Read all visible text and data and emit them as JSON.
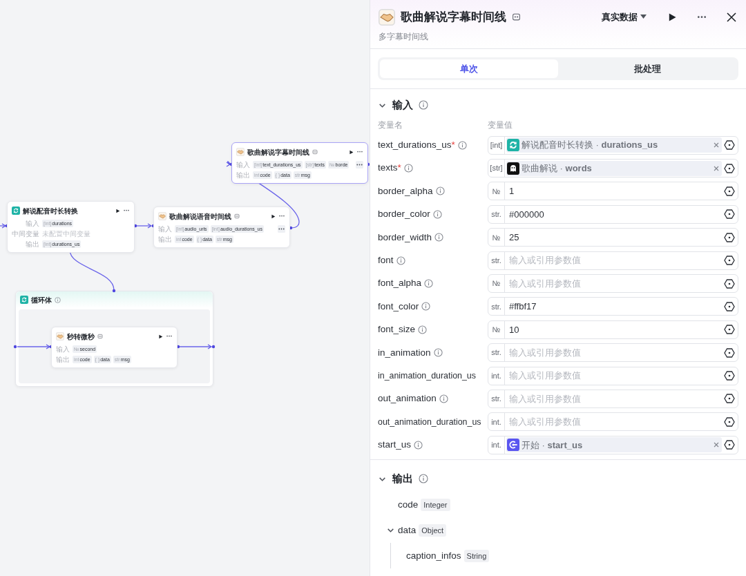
{
  "canvas": {
    "nodes": [
      {
        "title": "解说配音时长转换",
        "kind": "loop",
        "rows": [
          {
            "label": "输入",
            "tags": [
              {
                "type": "[int]",
                "name": "durations"
              }
            ]
          },
          {
            "label": "中间变量",
            "text": "未配置中间变量"
          },
          {
            "label": "输出",
            "tags": [
              {
                "type": "[int]",
                "name": "durations_us"
              }
            ]
          }
        ]
      },
      {
        "title": "歌曲解说语音时间线",
        "kind": "plugin",
        "edit_icon": true,
        "rows": [
          {
            "label": "输入",
            "tags": [
              {
                "type": "[int]",
                "name": "audio_urls"
              },
              {
                "type": "[int]",
                "name": "audio_durations_us"
              }
            ],
            "more": true
          },
          {
            "label": "输出",
            "tags": [
              {
                "type": "int",
                "name": "code"
              },
              {
                "type": "{ }",
                "name": "data"
              },
              {
                "type": "str",
                "name": "msg"
              }
            ]
          }
        ]
      },
      {
        "title": "歌曲解说字幕时间线",
        "kind": "plugin",
        "edit_icon": true,
        "rows": [
          {
            "label": "输入",
            "tags": [
              {
                "type": "[int]",
                "name": "text_durations_us"
              },
              {
                "type": "[str]",
                "name": "texts"
              },
              {
                "type": "№",
                "name": "borde"
              }
            ],
            "more": true
          },
          {
            "label": "输出",
            "tags": [
              {
                "type": "int",
                "name": "code"
              },
              {
                "type": "{ }",
                "name": "data"
              },
              {
                "type": "str",
                "name": "msg"
              }
            ]
          }
        ]
      }
    ],
    "loop": {
      "title": "循环体",
      "node": {
        "title": "秒转微秒",
        "kind": "plugin",
        "edit_icon": true,
        "rows": [
          {
            "label": "输入",
            "tags": [
              {
                "type": "№",
                "name": "second"
              }
            ]
          },
          {
            "label": "输出",
            "tags": [
              {
                "type": "int",
                "name": "code"
              },
              {
                "type": "{ }",
                "name": "data"
              },
              {
                "type": "str",
                "name": "msg"
              }
            ]
          }
        ]
      }
    }
  },
  "panel": {
    "title": "歌曲解说字幕时间线",
    "subtitle": "多字幕时间线",
    "mode": "真实数据",
    "tabs": [
      {
        "label": "单次",
        "selected": true
      },
      {
        "label": "批处理",
        "selected": false
      }
    ],
    "input": {
      "title": "输入",
      "expanded": true,
      "name_header": "变量名",
      "value_header": "变量值",
      "params": [
        {
          "name": "text_durations_us",
          "required_mark": "*",
          "info": true,
          "type": "[int]",
          "ref": {
            "kind": "loop",
            "text": "解说配音时长转换 · **durations_us**"
          }
        },
        {
          "name": "texts",
          "required_mark": "*",
          "info": true,
          "type": "[str]",
          "ref": {
            "kind": "avatar",
            "text": "歌曲解说 · **words**"
          }
        },
        {
          "name": "border_alpha",
          "info": true,
          "type": "№",
          "value": "1"
        },
        {
          "name": "border_color",
          "info": true,
          "type": "str.",
          "value": "#000000"
        },
        {
          "name": "border_width",
          "info": true,
          "type": "№",
          "value": "25"
        },
        {
          "name": "font",
          "info": true,
          "type": "str.",
          "placeholder": "输入或引用参数值"
        },
        {
          "name": "font_alpha",
          "info": true,
          "type": "№",
          "placeholder": "输入或引用参数值"
        },
        {
          "name": "font_color",
          "info": true,
          "type": "str.",
          "value": "#ffbf17"
        },
        {
          "name": "font_size",
          "info": true,
          "type": "№",
          "value": "10"
        },
        {
          "name": "in_animation",
          "info": true,
          "type": "str.",
          "placeholder": "输入或引用参数值"
        },
        {
          "name": "in_animation_duration_us",
          "info": false,
          "type": "int.",
          "placeholder": "输入或引用参数值"
        },
        {
          "name": "out_animation",
          "info": true,
          "type": "str.",
          "placeholder": "输入或引用参数值"
        },
        {
          "name": "out_animation_duration_us",
          "info": false,
          "type": "int.",
          "placeholder": "输入或引用参数值"
        },
        {
          "name": "start_us",
          "info": true,
          "type": "int.",
          "ref": {
            "kind": "start",
            "text": "开始 · **start_us**"
          }
        }
      ]
    },
    "output": {
      "title": "输出",
      "expanded": true,
      "fields": [
        {
          "name": "code",
          "type": "Integer"
        },
        {
          "name": "data",
          "type": "Object",
          "expanded": true,
          "children": [
            {
              "name": "caption_infos",
              "type": "String"
            }
          ]
        }
      ]
    }
  }
}
